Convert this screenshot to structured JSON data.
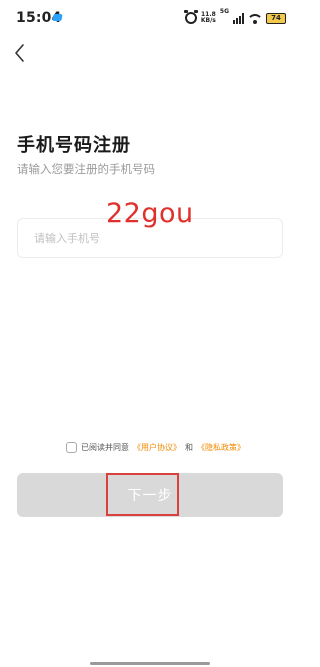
{
  "status_bar": {
    "time": "15:04",
    "net_speed_value": "11.8",
    "net_speed_unit": "KB/s",
    "network_type": "5G",
    "battery_level": "74",
    "battery_color": "#f2c94c"
  },
  "page": {
    "title": "手机号码注册",
    "subtitle": "请输入您要注册的手机号码"
  },
  "phone_input": {
    "placeholder": "请输入手机号",
    "value": ""
  },
  "watermark": "22gou",
  "agreement": {
    "prefix": "已阅读并同意",
    "user_agreement": "《用户协议》",
    "conjunction": "和",
    "privacy_policy": "《隐私政策》",
    "link_color": "#f08a00"
  },
  "next_button": {
    "label": "下一步",
    "color": "#d9d9d9"
  },
  "highlight": {
    "color": "#d9413c"
  }
}
